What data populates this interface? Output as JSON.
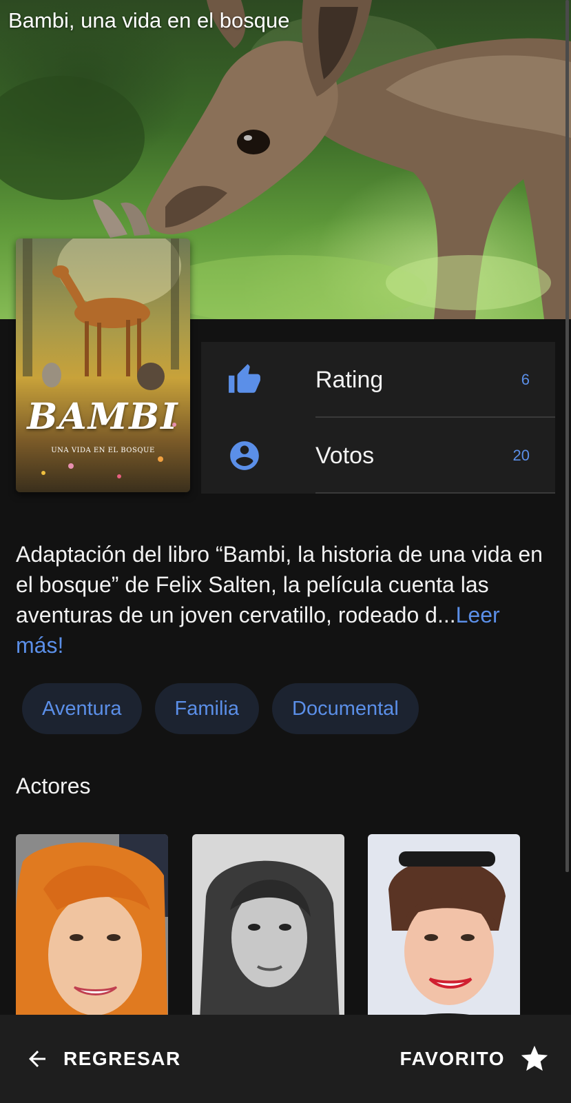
{
  "movie": {
    "title": "Bambi, una vida en el bosque",
    "poster_title": "BAMBI",
    "poster_tagline": "UNA VIDA EN EL BOSQUE"
  },
  "stats": {
    "rating": {
      "label": "Rating",
      "value": "6",
      "icon": "thumbs-up-icon"
    },
    "votes": {
      "label": "Votos",
      "value": "20",
      "icon": "account-circle-icon"
    }
  },
  "description": {
    "text": "Adaptación del libro “Bambi, la historia de una vida en el bosque” de Felix Salten, la película cuenta las aventuras de un joven cervatillo, rodeado d...",
    "read_more": "Leer más!"
  },
  "genres": [
    "Aventura",
    "Familia",
    "Documental"
  ],
  "actors_section": {
    "title": "Actores"
  },
  "bottom_bar": {
    "back_label": "REGRESAR",
    "back_icon": "arrow-left-icon",
    "favorite_label": "FAVORITO",
    "favorite_icon": "star-icon"
  },
  "colors": {
    "accent": "#5b8fe8",
    "background": "#121212",
    "surface": "#1e1e1e",
    "chip_background": "#1c2330"
  }
}
